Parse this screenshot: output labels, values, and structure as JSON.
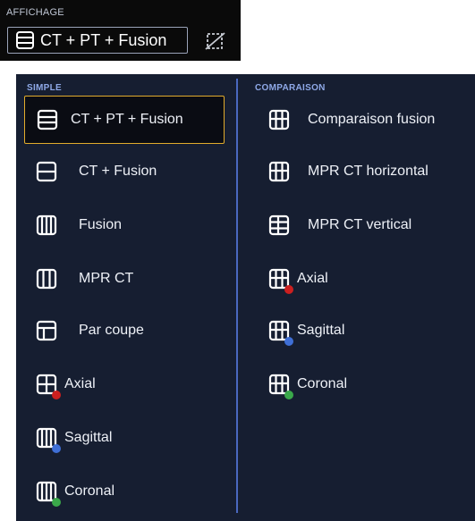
{
  "header": {
    "section_label": "AFFICHAGE",
    "current_selection": "CT + PT + Fusion",
    "current_icon": "layout-rows-3-icon",
    "toggle_icon": "crop-off-icon"
  },
  "menu": {
    "simple": {
      "header": "SIMPLE",
      "items": [
        {
          "label": "CT + PT + Fusion",
          "icon": "layout-rows-3-icon",
          "selected": true
        },
        {
          "label": "CT + Fusion",
          "icon": "layout-rows-2-icon"
        },
        {
          "label": "Fusion",
          "icon": "layout-columns-4-icon"
        },
        {
          "label": "MPR CT",
          "icon": "layout-columns-3-icon"
        },
        {
          "label": "Par coupe",
          "icon": "layout-sidebar-icon"
        },
        {
          "label": "Axial",
          "icon": "layout-grid-2x2-icon",
          "dot": "#cc1f1f"
        },
        {
          "label": "Sagittal",
          "icon": "layout-columns-4-icon",
          "dot": "#3f6fd6"
        },
        {
          "label": "Coronal",
          "icon": "layout-columns-4-icon",
          "dot": "#3aa84a"
        }
      ]
    },
    "comparison": {
      "header": "COMPARAISON",
      "items": [
        {
          "label": "Comparaison fusion",
          "icon": "layout-grid-3x3-icon"
        },
        {
          "label": "MPR CT horizontal",
          "icon": "layout-grid-3x3-icon"
        },
        {
          "label": "MPR CT vertical",
          "icon": "layout-grid-split-icon"
        },
        {
          "label": "Axial",
          "icon": "layout-grid-3x3-icon",
          "dot": "#cc1f1f"
        },
        {
          "label": "Sagittal",
          "icon": "layout-grid-3x3-icon",
          "dot": "#3f6fd6"
        },
        {
          "label": "Coronal",
          "icon": "layout-grid-3x3-icon",
          "dot": "#3aa84a"
        }
      ]
    }
  },
  "colors": {
    "panel_bg": "#161e31",
    "selected_border": "#e2ac2c",
    "header_text": "#8fa9e8",
    "divider": "#4a68bf"
  }
}
